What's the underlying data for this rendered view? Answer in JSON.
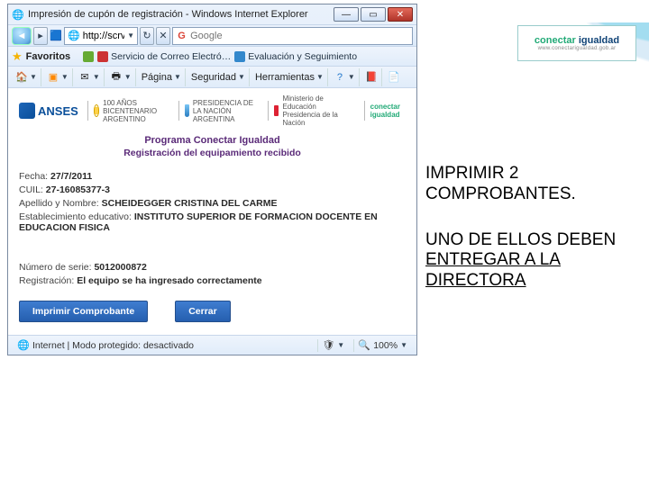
{
  "brand": {
    "line1a": "conectar",
    "line1b": "igualdad",
    "line2": "www.conectarigualdad.gob.ar"
  },
  "window": {
    "title": "Impresión de cupón de registración - Windows Internet Explorer",
    "url_prefix": "http://scrv..",
    "search_placeholder": "Google",
    "buttons": {
      "min": "—",
      "max": "▭",
      "close": "✕"
    }
  },
  "favbar": {
    "label": "Favoritos",
    "links": [
      "Servicio de Correo Electró…",
      "Evaluación y Seguimiento"
    ]
  },
  "cmdbar": {
    "items": [
      "Página",
      "Seguridad",
      "Herramientas"
    ]
  },
  "doc": {
    "anses": "ANSES",
    "chips": [
      "100 AÑOS BICENTENARIO ARGENTINO",
      "PRESIDENCIA DE LA NACIÓN ARGENTINA",
      "Ministerio de Educación Presidencia de la Nación",
      "conectar igualdad"
    ],
    "prog_title": "Programa Conectar Igualdad",
    "prog_sub": "Registración del equipamiento recibido",
    "fields": {
      "fecha_lbl": "Fecha:",
      "fecha_val": "27/7/2011",
      "cuil_lbl": "CUIL:",
      "cuil_val": "27-16085377-3",
      "nombre_lbl": "Apellido y Nombre:",
      "nombre_val": "SCHEIDEGGER CRISTINA DEL CARME",
      "est_lbl": "Establecimiento educativo:",
      "est_val": "INSTITUTO SUPERIOR DE FORMACION DOCENTE EN EDUCACION FISICA",
      "serie_lbl": "Número de serie:",
      "serie_val": "5012000872",
      "reg_lbl": "Registración:",
      "reg_val": "El equipo se ha ingresado correctamente"
    },
    "btn_print": "Imprimir Comprobante",
    "btn_close": "Cerrar"
  },
  "status": {
    "mode": "Internet | Modo protegido: desactivado",
    "zoom": "100%"
  },
  "instr": {
    "a1": "IMPRIMIR 2 COMPROBANTES.",
    "b_pre": "UNO DE ELLOS DEBEN ",
    "b_u": "ENTREGAR A LA DIRECTORA"
  }
}
